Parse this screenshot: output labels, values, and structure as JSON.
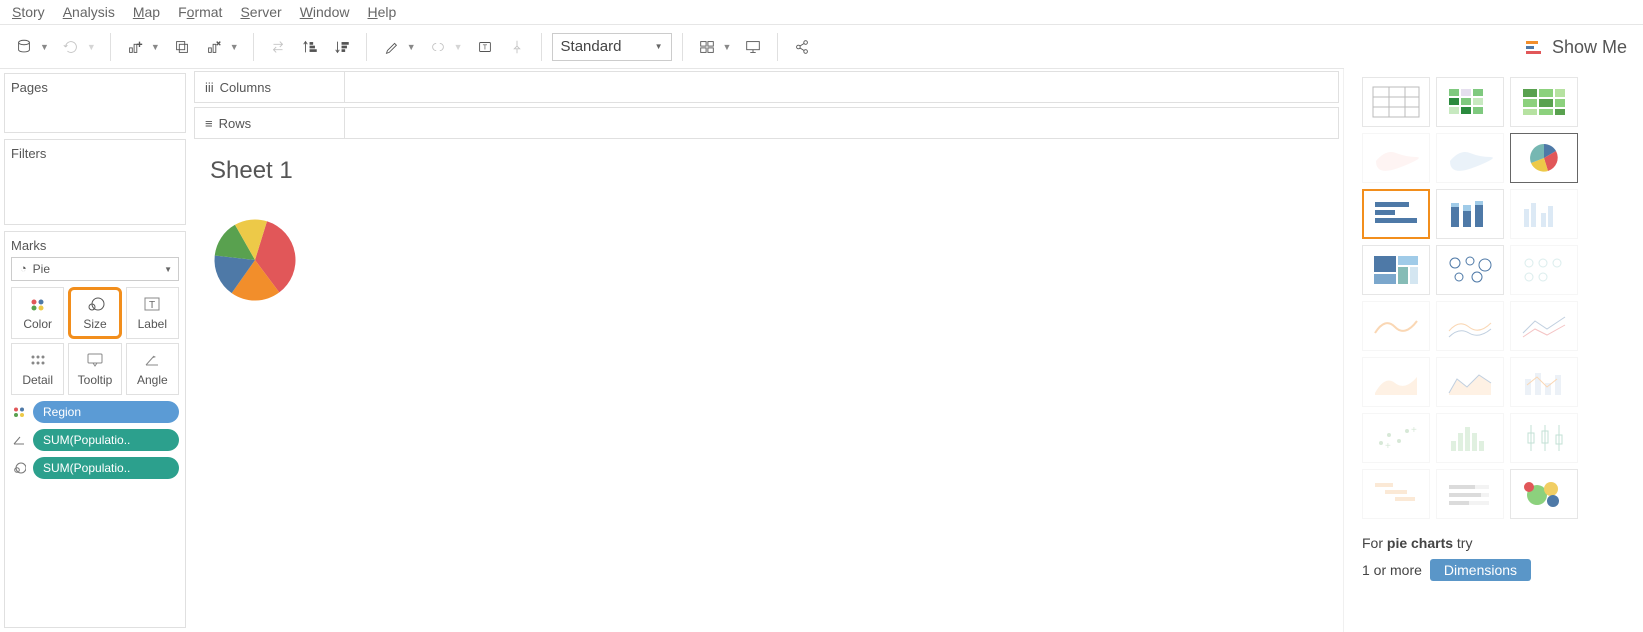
{
  "menu": {
    "items": [
      "Story",
      "Analysis",
      "Map",
      "Format",
      "Server",
      "Window",
      "Help"
    ]
  },
  "toolbar": {
    "fit_mode": "Standard"
  },
  "shelves": {
    "columns_label": "Columns",
    "rows_label": "Rows"
  },
  "panels": {
    "pages": "Pages",
    "filters": "Filters",
    "marks": "Marks"
  },
  "marks": {
    "type": "Pie",
    "cells": {
      "color": "Color",
      "size": "Size",
      "label": "Label",
      "detail": "Detail",
      "tooltip": "Tooltip",
      "angle": "Angle"
    },
    "pills": [
      {
        "icon": "dots",
        "label": "Region",
        "color": "blue"
      },
      {
        "icon": "angle",
        "label": "SUM(Populatio..",
        "color": "green"
      },
      {
        "icon": "size",
        "label": "SUM(Populatio..",
        "color": "green"
      }
    ]
  },
  "sheet": {
    "title": "Sheet 1"
  },
  "showme": {
    "title": "Show Me",
    "hint_prefix": "For ",
    "hint_bold": "pie charts",
    "hint_suffix": " try",
    "hint2_prefix": "1 or more ",
    "hint2_pill": "Dimensions"
  },
  "chart_data": {
    "type": "pie",
    "title": "",
    "series_field": "Region",
    "value_field": "SUM(Population)",
    "slices": [
      {
        "region": "Red",
        "value": 35,
        "color": "#e15759"
      },
      {
        "region": "Orange",
        "value": 20,
        "color": "#f28e2b"
      },
      {
        "region": "Blue",
        "value": 17,
        "color": "#4e79a7"
      },
      {
        "region": "Green",
        "value": 15,
        "color": "#59a14f"
      },
      {
        "region": "Yellow",
        "value": 13,
        "color": "#edc948"
      }
    ]
  }
}
